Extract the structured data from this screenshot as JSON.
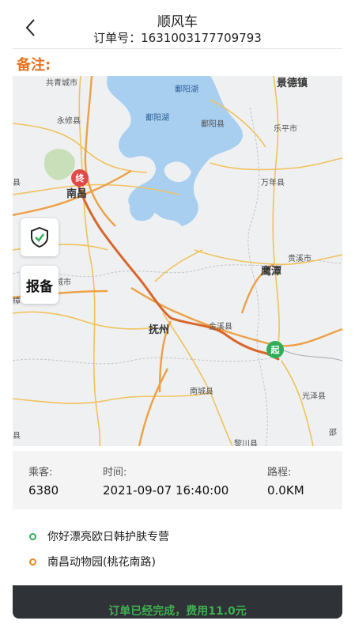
{
  "header": {
    "title": "顺风车",
    "order_number": "订单号：1631003177709793"
  },
  "remark_label": "备注:",
  "map": {
    "labels": {
      "gongqing": "共青城市",
      "poyang_lake_1": "鄱阳湖",
      "poyang_lake_2": "鄱阳湖",
      "jingdezhen": "景德镇",
      "yongxiu": "永修县",
      "poyang_county": "鄱阳县",
      "leping": "乐平市",
      "nanchang": "南昌",
      "wannian": "万年县",
      "guixi": "贵溪市",
      "yingtan": "鹰潭",
      "city_left": "城市",
      "zhang_left": "樟",
      "fuzhou": "抚州",
      "jinxi": "金溪县",
      "guangze": "光泽县",
      "nancheng": "南城县",
      "shao": "邵",
      "lichuan": "黎川县",
      "left_xian_1": "县",
      "left_xian_2": "县"
    },
    "markers": {
      "end": "终",
      "start": "起"
    },
    "icons": {
      "safety": "shield-check-icon"
    },
    "report_button": "报备"
  },
  "trip": {
    "passenger_label": "乘客:",
    "passenger_value": "6380",
    "time_label": "时间:",
    "time_value": "2021-09-07 16:40:00",
    "distance_label": "路程:",
    "distance_value": "0.0KM"
  },
  "addresses": {
    "from": "你好漂亮欧日韩护肤专营",
    "to": "南昌动物园(桃花南路)"
  },
  "footer": {
    "status": "订单已经完成，费用11.0元"
  },
  "colors": {
    "accent_orange": "#e8721d",
    "start_green": "#2fae5a",
    "end_red": "#e24a4a",
    "route": "#d9672a",
    "footer_bg": "#2f3237",
    "footer_text": "#3fae4f"
  }
}
